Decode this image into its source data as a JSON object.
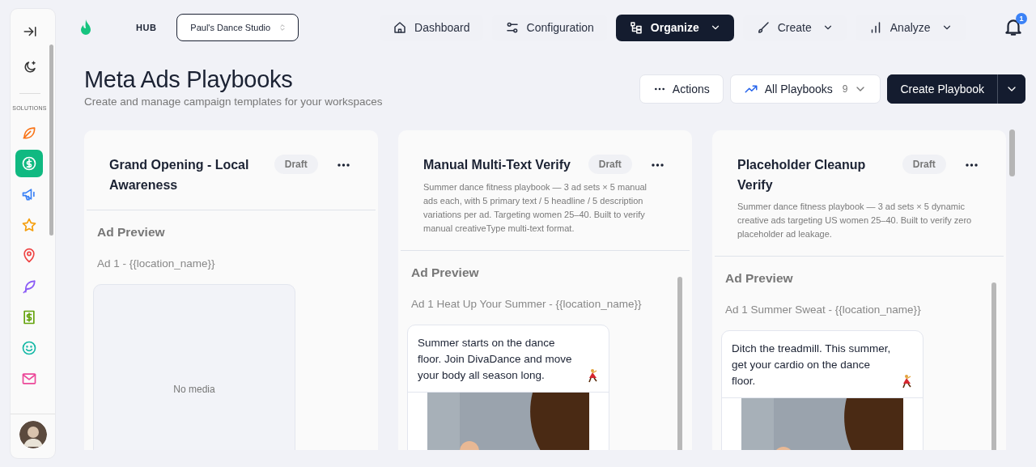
{
  "sidebar": {
    "label": "SOLUTIONS",
    "items": [
      {
        "color": "#f97316",
        "selected": false
      },
      {
        "color": "#10b981",
        "selected": true
      },
      {
        "color": "#3b82f6",
        "selected": false
      },
      {
        "color": "#f59e0b",
        "selected": false
      },
      {
        "color": "#ef4444",
        "selected": false
      },
      {
        "color": "#8b5cf6",
        "selected": false
      },
      {
        "color": "#65a30d",
        "selected": false
      },
      {
        "color": "#14b8a6",
        "selected": false
      },
      {
        "color": "#ec4899",
        "selected": false
      }
    ]
  },
  "header": {
    "hub_label": "HUB",
    "workspace": "Paul's Dance Studio",
    "nav": [
      {
        "label": "Dashboard",
        "selected": false,
        "dropdown": false
      },
      {
        "label": "Configuration",
        "selected": false,
        "dropdown": false
      },
      {
        "label": "Organize",
        "selected": true,
        "dropdown": true
      },
      {
        "label": "Create",
        "selected": false,
        "dropdown": true
      },
      {
        "label": "Analyze",
        "selected": false,
        "dropdown": true
      }
    ],
    "notifications": "1"
  },
  "page": {
    "title": "Meta Ads Playbooks",
    "subtitle": "Create and manage campaign templates for your workspaces",
    "actions": "Actions",
    "filter": {
      "label": "All Playbooks",
      "count": "9"
    },
    "primary": "Create Playbook"
  },
  "playbooks": [
    {
      "title": "Grand Opening - Local Awareness",
      "status": "Draft",
      "section": "Ad Preview",
      "ad_title": "Ad 1 - {{location_name}}",
      "media": {
        "kind": "empty",
        "text": "No media"
      }
    },
    {
      "title": "Manual Multi-Text Verify",
      "status": "Draft",
      "description": "Summer dance fitness playbook — 3 ad sets × 5 manual ads each, with 5 primary text / 5 headline / 5 description variations per ad. Targeting women 25–40. Built to verify manual creativeType multi-text format.",
      "section": "Ad Preview",
      "ad_title": "Ad 1 Heat Up Your Summer - {{location_name}}",
      "media": {
        "kind": "post",
        "text": "Summer starts on the dance floor. Join DivaDance and move your body all season long."
      }
    },
    {
      "title": "Placeholder Cleanup Verify",
      "status": "Draft",
      "description": "Summer dance fitness playbook — 3 ad sets × 5 dynamic creative ads targeting US women 25–40. Built to verify zero placeholder ad leakage.",
      "section": "Ad Preview",
      "ad_title": "Ad 1 Summer Sweat - {{location_name}}",
      "media": {
        "kind": "post",
        "text": "Ditch the treadmill. This summer, get your cardio on the dance floor."
      }
    }
  ]
}
